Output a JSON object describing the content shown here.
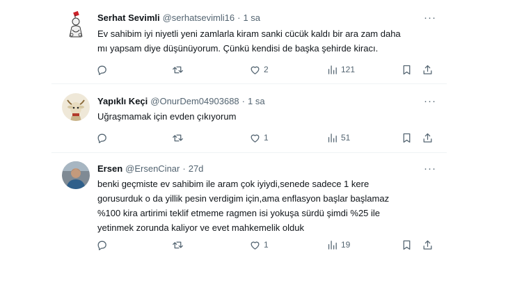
{
  "tweets": [
    {
      "name": "Serhat Sevimli",
      "handle": "@serhatsevimli16",
      "sep": "·",
      "time": "1 sa",
      "text": "Ev sahibim iyi niyetli yeni zamlarla kiram sanki cücük kaldı bir ara zam daha\nmı yapsam diye düşünüyorum. Çünkü kendisi de başka şehirde kiracı.",
      "likes": "2",
      "views": "121"
    },
    {
      "name": "Yapıklı Keçi",
      "handle": "@OnurDem04903688",
      "sep": "·",
      "time": "1 sa",
      "text": "Uğraşmamak için evden çıkıyorum",
      "likes": "1",
      "views": "51"
    },
    {
      "name": "Ersen",
      "handle": "@ErsenCinar",
      "sep": "·",
      "time": "27d",
      "text": "benki geçmiste ev sahibim ile aram çok iyiydi,senede sadece 1 kere\ngorusurduk o da yillik pesin verdigim için,ama enflasyon başlar başlamaz\n%100 kira artirimi teklif etmeme ragmen isi yokuşa sürdü şimdi %25 ile\nyetinmek zorunda kaliyor ve evet mahkemelik olduk",
      "likes": "1",
      "views": "19"
    }
  ],
  "icons": [
    "reply-icon",
    "retweet-icon",
    "like-icon",
    "views-icon",
    "bookmark-icon",
    "share-icon",
    "more-icon"
  ],
  "colors": {
    "text": "#0f1419",
    "muted": "#536471",
    "divider": "#eff3f4"
  }
}
